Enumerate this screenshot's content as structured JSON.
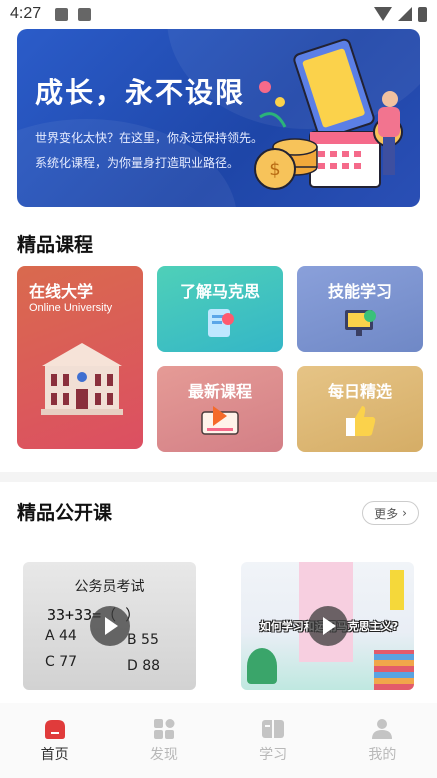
{
  "status": {
    "time": "4:27"
  },
  "banner": {
    "title": "成长，永不设限",
    "line1": "世界变化太快？在这里，你永远保持领先。",
    "line2": "系统化课程，为你量身打造职业路径。"
  },
  "courses": {
    "title": "精品课程",
    "featured": {
      "label": "在线大学",
      "sublabel": "Online University"
    },
    "cards": [
      "了解马克思",
      "技能学习",
      "最新课程",
      "每日精选"
    ]
  },
  "open_courses": {
    "title": "精品公开课",
    "more": "更多",
    "video1": {
      "heading": "公务员考试",
      "question": "33+33=（  ）",
      "a": "A 44",
      "b": "B 55",
      "c": "C 77",
      "d": "D 88"
    },
    "video2": {
      "caption": "如何学习和运用马克思主义?"
    }
  },
  "tabs": [
    "首页",
    "发现",
    "学习",
    "我的"
  ],
  "colors": {
    "banner": "#2b5cc9",
    "card_red": "#d9535a",
    "card_teal": "#3fc0b5",
    "card_blue": "#7d95cf",
    "card_pink": "#d98c88",
    "card_gold": "#d9b873",
    "accent": "#e03b3b"
  }
}
